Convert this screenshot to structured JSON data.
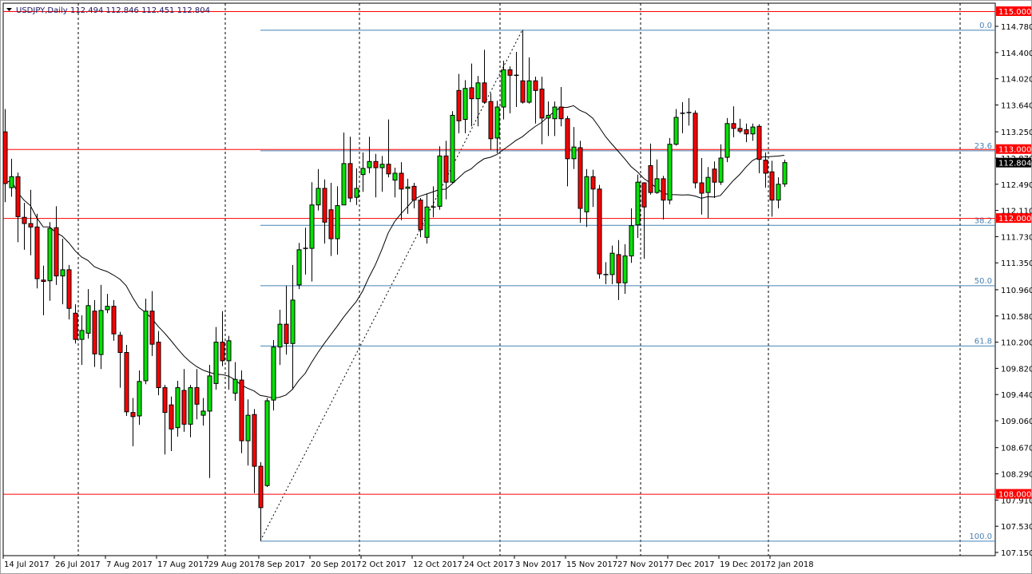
{
  "header": {
    "symbol": "USDJPY,Daily",
    "ohlc": "112.494 112.846 112.451 112.804"
  },
  "colors": {
    "bull": "#00e400",
    "bear": "#ff0000",
    "level_line": "#ff0000",
    "fib_line": "#4682b4",
    "ma_line": "#000000",
    "current_price_bg": "#000000"
  },
  "chart_data": {
    "type": "candlestick",
    "title": "USDJPY,Daily",
    "ylim": [
      107.15,
      115.0
    ],
    "y_ticks": [
      "114.780",
      "114.400",
      "114.020",
      "113.640",
      "113.250",
      "112.870",
      "112.490",
      "112.110",
      "111.730",
      "111.350",
      "110.960",
      "110.580",
      "110.200",
      "109.820",
      "109.440",
      "109.060",
      "108.670",
      "108.290",
      "107.910",
      "107.530",
      "107.150"
    ],
    "x_labels": [
      {
        "bar": 0,
        "label": "14 Jul 2017"
      },
      {
        "bar": 8,
        "label": "26 Jul 2017"
      },
      {
        "bar": 16,
        "label": "7 Aug 2017"
      },
      {
        "bar": 24,
        "label": "17 Aug 2017"
      },
      {
        "bar": 32,
        "label": "29 Aug 2017"
      },
      {
        "bar": 40,
        "label": "8 Sep 2017"
      },
      {
        "bar": 48,
        "label": "20 Sep 2017"
      },
      {
        "bar": 56,
        "label": "2 Oct 2017"
      },
      {
        "bar": 64,
        "label": "12 Oct 2017"
      },
      {
        "bar": 72,
        "label": "24 Oct 2017"
      },
      {
        "bar": 80,
        "label": "3 Nov 2017"
      },
      {
        "bar": 88,
        "label": "15 Nov 2017"
      },
      {
        "bar": 96,
        "label": "27 Nov 2017"
      },
      {
        "bar": 104,
        "label": "7 Dec 2017"
      },
      {
        "bar": 112,
        "label": "19 Dec 2017"
      },
      {
        "bar": 120,
        "label": "2 Jan 2018"
      }
    ],
    "month_separators_bar": [
      12,
      35,
      56,
      78,
      100,
      120,
      150
    ],
    "horizontal_levels": [
      {
        "price": 115.0,
        "label": "115.000"
      },
      {
        "price": 113.0,
        "label": "113.000"
      },
      {
        "price": 112.0,
        "label": "112.000"
      },
      {
        "price": 108.0,
        "label": "108.000"
      }
    ],
    "current_price": {
      "price": 112.804,
      "label": "112.804"
    },
    "fibonacci": {
      "low": {
        "bar": 40,
        "price": 107.32
      },
      "high": {
        "bar": 81,
        "price": 114.73
      },
      "levels": [
        {
          "ratio": 0.0,
          "label": "0.0"
        },
        {
          "ratio": 0.236,
          "label": "23.6"
        },
        {
          "ratio": 0.382,
          "label": "38.2"
        },
        {
          "ratio": 0.5,
          "label": "50.0"
        },
        {
          "ratio": 0.618,
          "label": "61.8"
        },
        {
          "ratio": 1.0,
          "label": "100.0"
        }
      ]
    },
    "moving_average": {
      "type": "SMA",
      "period": 20
    },
    "ohlc": [
      [
        113.25,
        113.58,
        112.23,
        112.5
      ],
      [
        112.44,
        112.86,
        112.31,
        112.6
      ],
      [
        112.6,
        112.66,
        111.65,
        112.02
      ],
      [
        112.01,
        112.22,
        111.54,
        111.92
      ],
      [
        111.92,
        112.41,
        111.46,
        111.87
      ],
      [
        111.87,
        112.06,
        110.98,
        111.12
      ],
      [
        111.1,
        111.31,
        110.59,
        111.08
      ],
      [
        111.09,
        111.94,
        110.8,
        111.85
      ],
      [
        111.86,
        112.17,
        111.03,
        111.16
      ],
      [
        111.16,
        111.7,
        110.75,
        111.25
      ],
      [
        111.25,
        111.32,
        110.53,
        110.69
      ],
      [
        110.62,
        110.75,
        110.18,
        110.24
      ],
      [
        110.24,
        110.59,
        109.87,
        110.37
      ],
      [
        110.33,
        110.97,
        110.25,
        110.73
      ],
      [
        110.65,
        110.81,
        109.84,
        110.03
      ],
      [
        110.02,
        111.03,
        109.81,
        110.66
      ],
      [
        110.67,
        110.9,
        110.62,
        110.72
      ],
      [
        110.72,
        110.81,
        110.22,
        110.32
      ],
      [
        110.3,
        110.35,
        109.54,
        110.05
      ],
      [
        110.05,
        110.16,
        109.13,
        109.19
      ],
      [
        109.18,
        109.39,
        108.69,
        109.12
      ],
      [
        109.13,
        109.79,
        109.0,
        109.63
      ],
      [
        109.64,
        110.83,
        109.59,
        110.65
      ],
      [
        110.65,
        110.94,
        110.0,
        110.17
      ],
      [
        110.2,
        110.36,
        109.43,
        109.54
      ],
      [
        109.54,
        109.58,
        108.57,
        109.18
      ],
      [
        109.29,
        109.41,
        108.62,
        108.94
      ],
      [
        108.96,
        109.64,
        108.83,
        109.54
      ],
      [
        109.5,
        109.81,
        108.9,
        109.01
      ],
      [
        109.01,
        109.58,
        108.82,
        109.54
      ],
      [
        109.54,
        109.81,
        109.08,
        109.3
      ],
      [
        109.14,
        109.39,
        108.99,
        109.2
      ],
      [
        109.2,
        109.87,
        108.23,
        109.71
      ],
      [
        109.6,
        110.42,
        109.51,
        110.2
      ],
      [
        110.2,
        110.65,
        109.85,
        109.93
      ],
      [
        109.93,
        110.29,
        109.51,
        110.22
      ],
      [
        109.46,
        109.91,
        109.35,
        109.66
      ],
      [
        109.65,
        109.79,
        108.59,
        108.77
      ],
      [
        108.77,
        109.37,
        108.41,
        109.14
      ],
      [
        109.15,
        109.23,
        108.01,
        108.4
      ],
      [
        108.4,
        108.46,
        107.32,
        107.8
      ],
      [
        108.12,
        109.39,
        108.1,
        109.35
      ],
      [
        109.36,
        110.23,
        109.21,
        110.13
      ],
      [
        110.13,
        110.67,
        109.87,
        110.46
      ],
      [
        110.46,
        111.02,
        110.02,
        110.18
      ],
      [
        110.18,
        111.32,
        109.51,
        110.81
      ],
      [
        111.03,
        111.64,
        110.97,
        111.54
      ],
      [
        111.55,
        111.86,
        111.18,
        111.56
      ],
      [
        111.56,
        112.52,
        111.08,
        112.19
      ],
      [
        112.19,
        112.71,
        112.11,
        112.43
      ],
      [
        112.43,
        112.56,
        111.63,
        111.94
      ],
      [
        112.12,
        112.51,
        111.45,
        111.7
      ],
      [
        111.7,
        112.46,
        111.47,
        112.18
      ],
      [
        112.19,
        113.24,
        112.19,
        112.79
      ],
      [
        112.79,
        113.18,
        112.23,
        112.29
      ],
      [
        112.3,
        112.72,
        112.19,
        112.43
      ],
      [
        112.63,
        112.95,
        112.38,
        112.72
      ],
      [
        112.73,
        113.18,
        112.65,
        112.82
      ],
      [
        112.82,
        112.93,
        112.3,
        112.73
      ],
      [
        112.73,
        112.9,
        112.38,
        112.78
      ],
      [
        112.78,
        113.43,
        112.59,
        112.64
      ],
      [
        112.55,
        112.73,
        112.3,
        112.65
      ],
      [
        112.65,
        112.81,
        111.97,
        112.42
      ],
      [
        112.43,
        112.57,
        112.06,
        112.45
      ],
      [
        112.46,
        112.51,
        112.14,
        112.26
      ],
      [
        112.26,
        112.29,
        111.72,
        111.83
      ],
      [
        111.72,
        112.35,
        111.63,
        112.16
      ],
      [
        112.15,
        112.46,
        112.01,
        112.16
      ],
      [
        112.17,
        113.04,
        112.12,
        112.9
      ],
      [
        112.9,
        113.12,
        112.27,
        112.52
      ],
      [
        112.52,
        113.55,
        112.5,
        113.49
      ],
      [
        113.85,
        114.09,
        113.23,
        113.41
      ],
      [
        113.43,
        114.0,
        113.23,
        113.88
      ],
      [
        113.89,
        114.24,
        113.33,
        113.73
      ],
      [
        113.73,
        114.06,
        113.33,
        113.96
      ],
      [
        113.96,
        114.44,
        113.66,
        113.68
      ],
      [
        113.69,
        113.81,
        112.99,
        113.15
      ],
      [
        113.16,
        113.7,
        112.94,
        113.61
      ],
      [
        113.61,
        114.28,
        113.43,
        114.15
      ],
      [
        114.15,
        114.2,
        113.52,
        114.07
      ],
      [
        114.07,
        114.41,
        113.61,
        114.06
      ],
      [
        113.99,
        114.73,
        113.66,
        113.68
      ],
      [
        113.68,
        114.33,
        113.66,
        113.99
      ],
      [
        113.99,
        114.05,
        113.37,
        113.85
      ],
      [
        113.87,
        114.05,
        113.07,
        113.45
      ],
      [
        113.45,
        113.69,
        113.19,
        113.49
      ],
      [
        113.44,
        113.69,
        113.19,
        113.61
      ],
      [
        113.61,
        113.9,
        113.33,
        113.44
      ],
      [
        113.44,
        113.48,
        112.46,
        112.86
      ],
      [
        112.86,
        113.32,
        112.71,
        113.03
      ],
      [
        113.02,
        113.12,
        111.93,
        112.14
      ],
      [
        112.09,
        112.71,
        111.87,
        112.6
      ],
      [
        112.6,
        112.7,
        112.16,
        112.42
      ],
      [
        112.42,
        112.48,
        111.12,
        111.19
      ],
      [
        111.18,
        111.36,
        111.04,
        111.17
      ],
      [
        111.18,
        111.6,
        111.04,
        111.49
      ],
      [
        111.47,
        111.68,
        110.81,
        111.06
      ],
      [
        111.06,
        111.62,
        110.9,
        111.45
      ],
      [
        111.45,
        112.14,
        111.35,
        111.89
      ],
      [
        111.9,
        112.63,
        111.71,
        112.52
      ],
      [
        112.51,
        112.52,
        111.41,
        112.16
      ],
      [
        112.76,
        113.08,
        112.34,
        112.37
      ],
      [
        112.37,
        112.85,
        112.35,
        112.57
      ],
      [
        112.57,
        112.61,
        111.98,
        112.26
      ],
      [
        112.26,
        113.16,
        112.2,
        113.07
      ],
      [
        113.07,
        113.58,
        113.05,
        113.46
      ],
      [
        113.52,
        113.68,
        113.23,
        113.51
      ],
      [
        113.52,
        113.74,
        113.34,
        113.53
      ],
      [
        113.52,
        113.56,
        112.43,
        112.51
      ],
      [
        112.51,
        112.87,
        112.05,
        112.36
      ],
      [
        112.37,
        112.74,
        112.0,
        112.59
      ],
      [
        112.71,
        112.82,
        112.29,
        112.52
      ],
      [
        112.52,
        113.07,
        112.48,
        112.87
      ],
      [
        112.88,
        113.45,
        112.81,
        113.37
      ],
      [
        113.37,
        113.62,
        113.17,
        113.3
      ],
      [
        113.3,
        113.44,
        113.23,
        113.26
      ],
      [
        113.28,
        113.37,
        113.1,
        113.22
      ],
      [
        113.22,
        113.37,
        113.12,
        113.32
      ],
      [
        113.33,
        113.36,
        112.65,
        112.85
      ],
      [
        112.84,
        112.95,
        112.44,
        112.65
      ],
      [
        112.67,
        112.83,
        112.02,
        112.26
      ],
      [
        112.26,
        112.59,
        112.14,
        112.49
      ],
      [
        112.494,
        112.846,
        112.451,
        112.804
      ]
    ]
  }
}
